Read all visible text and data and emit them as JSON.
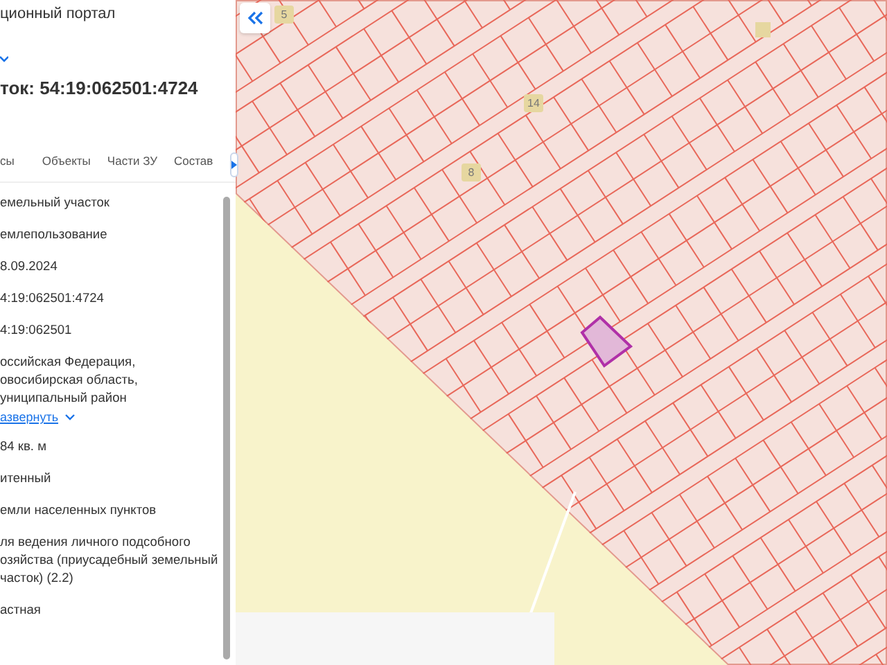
{
  "header": {
    "portal_title": "ционный портал",
    "parcel_heading": "ток: 54:19:062501:4724"
  },
  "tabs": [
    {
      "label": "сы",
      "selected": false
    },
    {
      "label": "Объекты",
      "selected": false
    },
    {
      "label": "Части ЗУ",
      "selected": false
    },
    {
      "label": "Состав",
      "selected": false
    }
  ],
  "details": [
    {
      "kind": "text",
      "value": "емельный участок"
    },
    {
      "kind": "text",
      "value": "емлепользование"
    },
    {
      "kind": "text",
      "value": "8.09.2024"
    },
    {
      "kind": "text",
      "value": "4:19:062501:4724"
    },
    {
      "kind": "text",
      "value": "4:19:062501"
    },
    {
      "kind": "text",
      "value": "оссийская Федерация,\nовосибирская область,\nуниципальный район"
    },
    {
      "kind": "link",
      "value": "азвернуть"
    },
    {
      "kind": "text",
      "value": "84 кв. м"
    },
    {
      "kind": "text",
      "value": "итенный"
    },
    {
      "kind": "text",
      "value": "емли населенных пунктов"
    },
    {
      "kind": "text",
      "value": "ля ведения личного подсобного\nозяйства (приусадебный земельный\nчасток) (2.2)"
    },
    {
      "kind": "text",
      "value": "астная"
    }
  ],
  "map": {
    "labels": [
      {
        "text": "5"
      },
      {
        "text": "14"
      },
      {
        "text": "8"
      }
    ]
  }
}
